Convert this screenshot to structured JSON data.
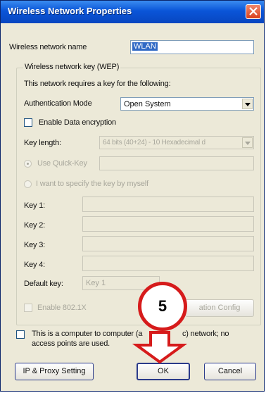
{
  "window": {
    "title": "Wireless Network Properties"
  },
  "network_name": {
    "label": "Wireless network name",
    "value": "WLAN"
  },
  "wep_group": {
    "title": "Wireless network key (WEP)",
    "description": "This network requires a key for the following:",
    "auth_mode": {
      "label": "Authentication Mode",
      "value": "Open System"
    },
    "enable_encryption": {
      "label": "Enable Data encryption",
      "checked": false
    },
    "key_length": {
      "label": "Key length:",
      "value": "64 bits (40+24) - 10 Hexadecimal d"
    },
    "use_quick_key": {
      "label": "Use Quick-Key"
    },
    "specify_key": {
      "label": "I want to specify the key by myself"
    },
    "keys": [
      {
        "label": "Key 1:"
      },
      {
        "label": "Key 2:"
      },
      {
        "label": "Key 3:"
      },
      {
        "label": "Key 4:"
      }
    ],
    "default_key": {
      "label": "Default key:",
      "value": "Key 1"
    },
    "enable_8021x": {
      "label": "Enable 802.1X"
    },
    "config_button": "ation Config"
  },
  "adhoc": {
    "label_line1": "This is a computer to computer (a",
    "label_line1b": "c) network; no",
    "label_line2": "access points are used."
  },
  "buttons": {
    "ip_proxy": "IP & Proxy Setting",
    "ok": "OK",
    "cancel": "Cancel"
  },
  "annotation": {
    "step": "5",
    "color": "#d61b1b"
  }
}
